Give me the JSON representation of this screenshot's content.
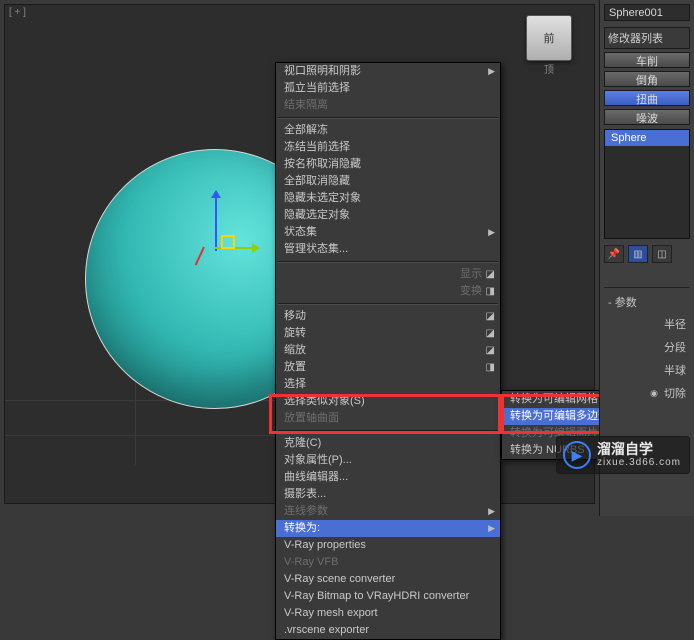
{
  "viewport": {
    "label": "[ + ]"
  },
  "viewcube": {
    "face": "前",
    "label": "顶"
  },
  "menu": {
    "items": [
      {
        "label": "视口照明和阴影",
        "sub": true
      },
      {
        "label": "孤立当前选择"
      },
      {
        "label": "结束隔离",
        "disabled": true
      },
      {
        "sep": true
      },
      {
        "label": "全部解冻"
      },
      {
        "label": "冻结当前选择"
      },
      {
        "label": "按名称取消隐藏"
      },
      {
        "label": "全部取消隐藏"
      },
      {
        "label": "隐藏未选定对象"
      },
      {
        "label": "隐藏选定对象"
      },
      {
        "label": "状态集",
        "sub": true
      },
      {
        "label": "管理状态集..."
      },
      {
        "sep": true
      },
      {
        "label": "显示",
        "right": true,
        "disabled": true,
        "align": "right"
      },
      {
        "label": "变换",
        "right": true,
        "disabled": true,
        "align": "right",
        "alt": true
      },
      {
        "sep": true
      },
      {
        "label": "移动",
        "right": true
      },
      {
        "label": "旋转",
        "right": true
      },
      {
        "label": "缩放",
        "right": true
      },
      {
        "label": "放置",
        "right": true,
        "alt": true
      },
      {
        "label": "选择"
      },
      {
        "label": "选择类似对象(S)"
      },
      {
        "label": "放置轴曲面",
        "disabled": true
      },
      {
        "sep": true
      },
      {
        "label": "克隆(C)"
      },
      {
        "label": "对象属性(P)..."
      },
      {
        "label": "曲线编辑器..."
      },
      {
        "label": "摄影表..."
      },
      {
        "label": "连线参数",
        "sub": true,
        "disabled": true
      },
      {
        "label": "转换为:",
        "sub": true,
        "highlight": true
      },
      {
        "label": "V-Ray properties"
      },
      {
        "label": "V-Ray VFB",
        "disabled": true
      },
      {
        "label": "V-Ray scene converter"
      },
      {
        "label": "V-Ray Bitmap to VRayHDRI converter"
      },
      {
        "label": "V-Ray mesh export"
      },
      {
        "label": ".vrscene exporter"
      }
    ]
  },
  "submenu": {
    "items": [
      {
        "label": "转换为可编辑网格"
      },
      {
        "label": "转换为可编辑多边形",
        "highlight": true
      },
      {
        "label": "转换为可编辑面片",
        "disabled": true
      },
      {
        "label": "转换为 NURBS"
      }
    ]
  },
  "panel": {
    "object_name": "Sphere001",
    "modifier_title": "修改器列表",
    "btns": [
      "车削",
      "倒角",
      "扭曲",
      "噪波"
    ],
    "stack_sel": "Sphere",
    "rollout_title": "- 参数",
    "params": [
      "半径",
      "分段",
      "半球"
    ],
    "cut_label": "切除",
    "pin": "📌"
  },
  "watermark": {
    "brand": "溜溜自学",
    "sub": "zixue.3d66.com",
    "play": "▶"
  }
}
